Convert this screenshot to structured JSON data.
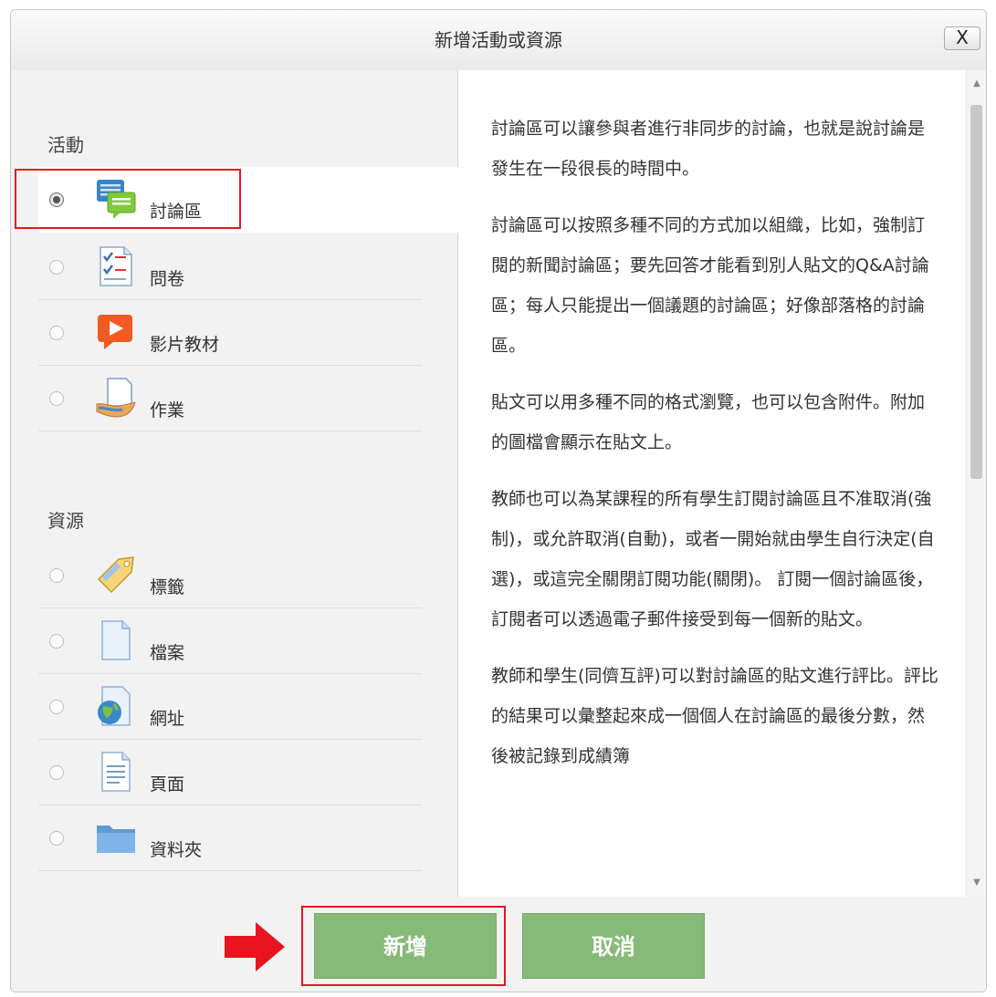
{
  "dialog": {
    "title": "新增活動或資源",
    "close_label": "X"
  },
  "activities": {
    "heading": "活動",
    "items": [
      {
        "label": "討論區",
        "icon": "forum-icon",
        "selected": true
      },
      {
        "label": "問卷",
        "icon": "questionnaire-icon",
        "selected": false
      },
      {
        "label": "影片教材",
        "icon": "video-icon",
        "selected": false
      },
      {
        "label": "作業",
        "icon": "assignment-icon",
        "selected": false
      }
    ]
  },
  "resources": {
    "heading": "資源",
    "items": [
      {
        "label": "標籤",
        "icon": "label-icon",
        "selected": false
      },
      {
        "label": "檔案",
        "icon": "file-icon",
        "selected": false
      },
      {
        "label": "網址",
        "icon": "url-icon",
        "selected": false
      },
      {
        "label": "頁面",
        "icon": "page-icon",
        "selected": false
      },
      {
        "label": "資料夾",
        "icon": "folder-icon",
        "selected": false
      }
    ]
  },
  "summary": {
    "paragraphs": [
      "討論區可以讓參與者進行非同步的討論，也就是說討論是發生在一段很長的時間中。",
      "討論區可以按照多種不同的方式加以組織，比如，強制訂閱的新聞討論區；要先回答才能看到別人貼文的Q&A討論區；每人只能提出一個議題的討論區；好像部落格的討論區。",
      "貼文可以用多種不同的格式瀏覽，也可以包含附件。附加的圖檔會顯示在貼文上。",
      "教師也可以為某課程的所有學生訂閱討論區且不准取消(強制)，或允許取消(自動)，或者一開始就由學生自行決定(自選)，或這完全關閉訂閱功能(關閉)。 訂閱一個討論區後，訂閱者可以透過電子郵件接受到每一個新的貼文。",
      "教師和學生(同儕互評)可以對討論區的貼文進行評比。評比的結果可以彙整起來成一個個人在討論區的最後分數，然後被記錄到成績簿"
    ]
  },
  "footer": {
    "add_label": "新增",
    "cancel_label": "取消"
  },
  "colors": {
    "button_green": "#86ba78",
    "highlight_red": "#e8141f"
  }
}
